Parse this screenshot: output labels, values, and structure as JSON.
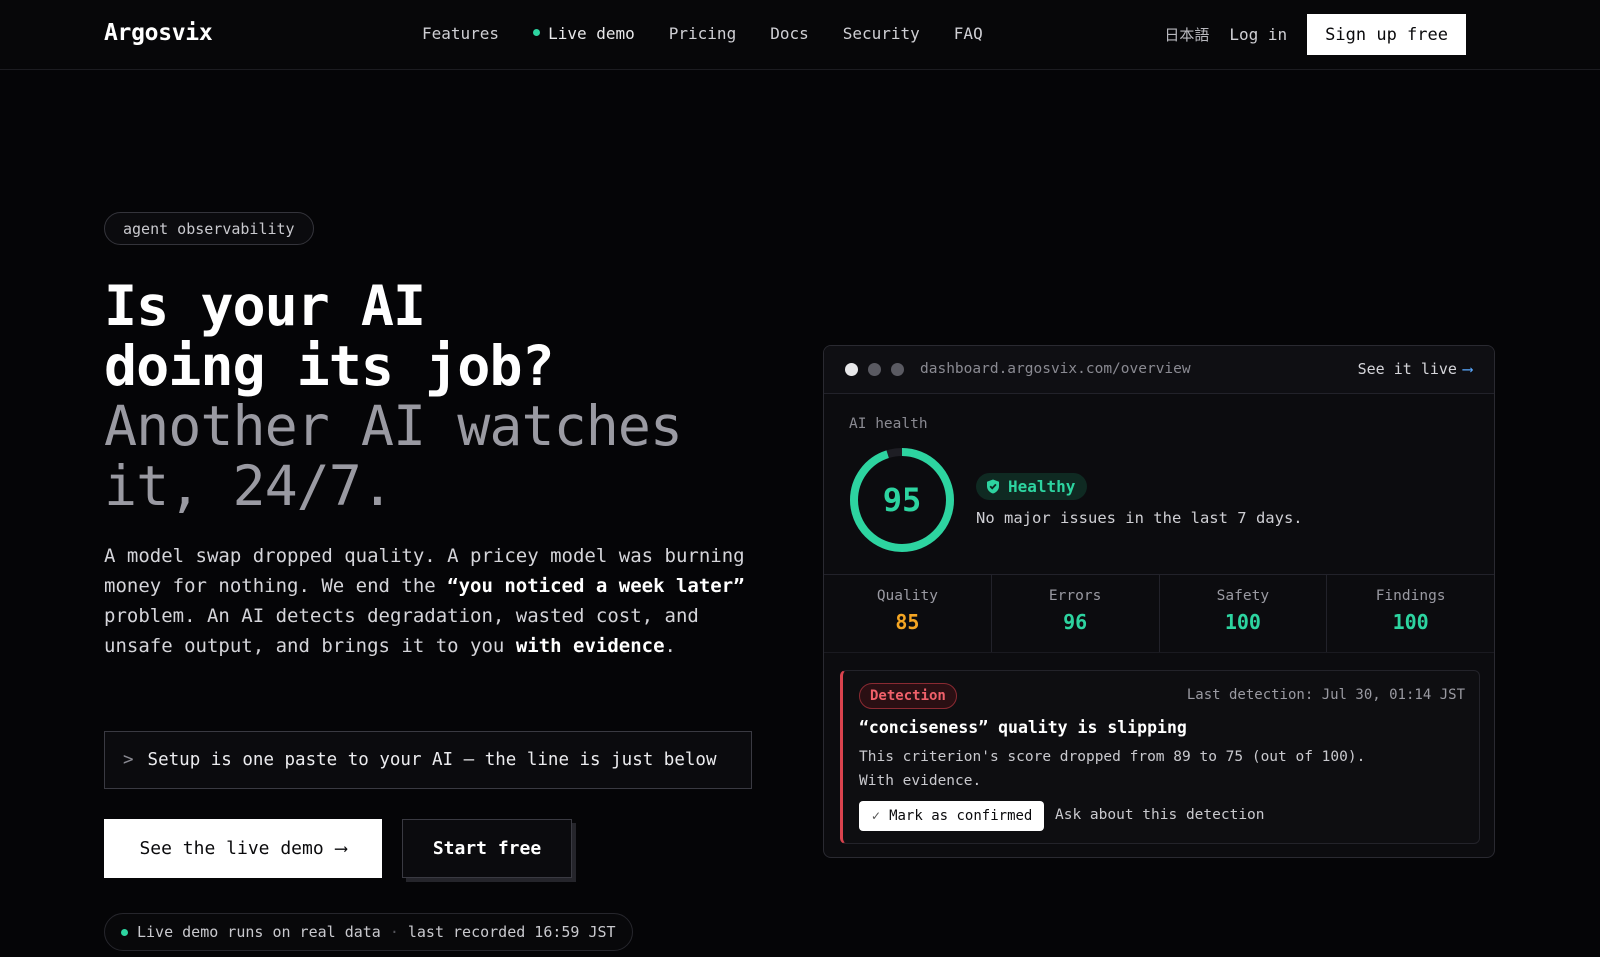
{
  "header": {
    "logo": "Argosvix",
    "nav": [
      "Features",
      "Live demo",
      "Pricing",
      "Docs",
      "Security",
      "FAQ"
    ],
    "lang": "日本語",
    "login": "Log in",
    "signup": "Sign up free"
  },
  "hero": {
    "badge": "agent observability",
    "headline_line1": "Is your AI",
    "headline_line2": "doing its job?",
    "headline_line3": "Another AI watches",
    "headline_line4": "it, 24/7.",
    "lead_p1": "A model swap dropped quality. A pricey model was burning money for nothing. We end the ",
    "lead_bold1": "“you noticed a week later”",
    "lead_p2": " problem. An AI detects degradation, wasted cost, and unsafe output, and brings it to you ",
    "lead_bold2": "with evidence",
    "lead_p3": ".",
    "setup_prompt": ">",
    "setup_text": "Setup is one paste to your AI — the line is just below",
    "demo_button": "See the live demo",
    "demo_arrow": "⟶",
    "start_button": "Start free",
    "live_note_1": "Live demo runs on real data",
    "live_note_sep": "·",
    "live_note_2": "last recorded 16:59 JST"
  },
  "dashboard": {
    "url": "dashboard.argosvix.com/overview",
    "see_live": "See it live",
    "see_live_arrow": "⟶",
    "health_label": "AI health",
    "score": 95,
    "score_text": "95",
    "status": "Healthy",
    "status_desc": "No major issues in the last 7 days.",
    "metrics": [
      {
        "label": "Quality",
        "value": "85",
        "color": "#f5a623"
      },
      {
        "label": "Errors",
        "value": "96",
        "color": "#2dd4a0"
      },
      {
        "label": "Safety",
        "value": "100",
        "color": "#2dd4a0"
      },
      {
        "label": "Findings",
        "value": "100",
        "color": "#2dd4a0"
      }
    ],
    "detection": {
      "tag": "Detection",
      "time": "Last detection: Jul 30, 01:14 JST",
      "title": "“conciseness” quality is slipping",
      "body1": "This criterion's score dropped from 89 to 75 (out of 100).",
      "body2": "With evidence.",
      "confirm": "Mark as confirmed",
      "ask": "Ask about this detection"
    }
  },
  "colors": {
    "accent": "#2dd4a0",
    "warning": "#f5a623",
    "danger": "#d9434e",
    "link": "#5aa9ff"
  }
}
